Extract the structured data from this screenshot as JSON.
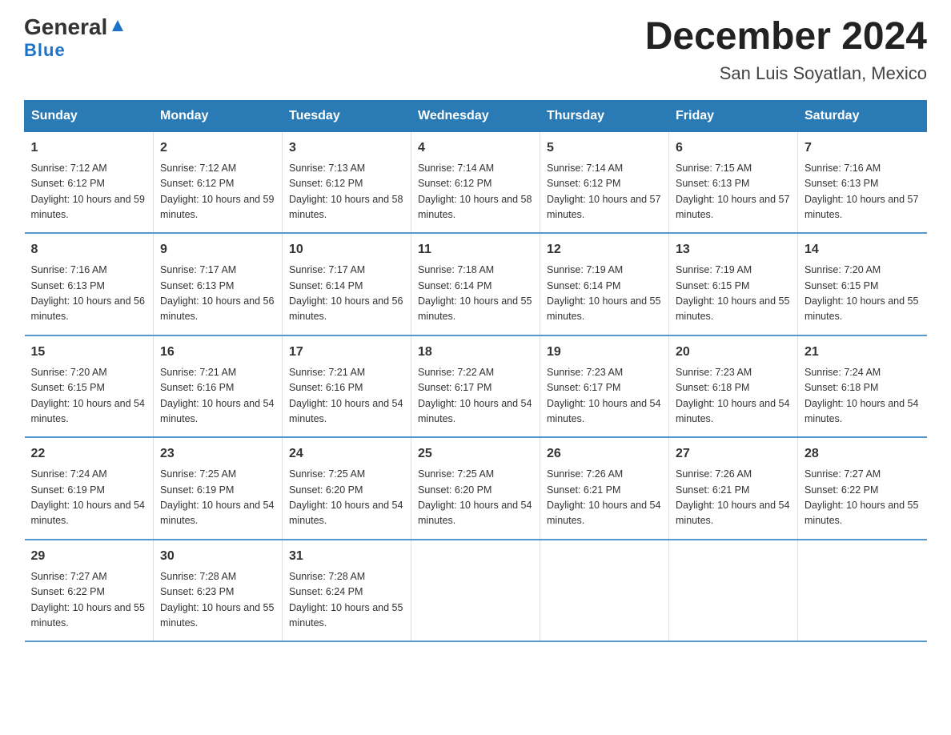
{
  "header": {
    "logo_general": "General",
    "logo_blue": "Blue",
    "month_title": "December 2024",
    "location": "San Luis Soyatlan, Mexico"
  },
  "days_of_week": [
    "Sunday",
    "Monday",
    "Tuesday",
    "Wednesday",
    "Thursday",
    "Friday",
    "Saturday"
  ],
  "weeks": [
    [
      {
        "day": "1",
        "sunrise": "7:12 AM",
        "sunset": "6:12 PM",
        "daylight": "10 hours and 59 minutes."
      },
      {
        "day": "2",
        "sunrise": "7:12 AM",
        "sunset": "6:12 PM",
        "daylight": "10 hours and 59 minutes."
      },
      {
        "day": "3",
        "sunrise": "7:13 AM",
        "sunset": "6:12 PM",
        "daylight": "10 hours and 58 minutes."
      },
      {
        "day": "4",
        "sunrise": "7:14 AM",
        "sunset": "6:12 PM",
        "daylight": "10 hours and 58 minutes."
      },
      {
        "day": "5",
        "sunrise": "7:14 AM",
        "sunset": "6:12 PM",
        "daylight": "10 hours and 57 minutes."
      },
      {
        "day": "6",
        "sunrise": "7:15 AM",
        "sunset": "6:13 PM",
        "daylight": "10 hours and 57 minutes."
      },
      {
        "day": "7",
        "sunrise": "7:16 AM",
        "sunset": "6:13 PM",
        "daylight": "10 hours and 57 minutes."
      }
    ],
    [
      {
        "day": "8",
        "sunrise": "7:16 AM",
        "sunset": "6:13 PM",
        "daylight": "10 hours and 56 minutes."
      },
      {
        "day": "9",
        "sunrise": "7:17 AM",
        "sunset": "6:13 PM",
        "daylight": "10 hours and 56 minutes."
      },
      {
        "day": "10",
        "sunrise": "7:17 AM",
        "sunset": "6:14 PM",
        "daylight": "10 hours and 56 minutes."
      },
      {
        "day": "11",
        "sunrise": "7:18 AM",
        "sunset": "6:14 PM",
        "daylight": "10 hours and 55 minutes."
      },
      {
        "day": "12",
        "sunrise": "7:19 AM",
        "sunset": "6:14 PM",
        "daylight": "10 hours and 55 minutes."
      },
      {
        "day": "13",
        "sunrise": "7:19 AM",
        "sunset": "6:15 PM",
        "daylight": "10 hours and 55 minutes."
      },
      {
        "day": "14",
        "sunrise": "7:20 AM",
        "sunset": "6:15 PM",
        "daylight": "10 hours and 55 minutes."
      }
    ],
    [
      {
        "day": "15",
        "sunrise": "7:20 AM",
        "sunset": "6:15 PM",
        "daylight": "10 hours and 54 minutes."
      },
      {
        "day": "16",
        "sunrise": "7:21 AM",
        "sunset": "6:16 PM",
        "daylight": "10 hours and 54 minutes."
      },
      {
        "day": "17",
        "sunrise": "7:21 AM",
        "sunset": "6:16 PM",
        "daylight": "10 hours and 54 minutes."
      },
      {
        "day": "18",
        "sunrise": "7:22 AM",
        "sunset": "6:17 PM",
        "daylight": "10 hours and 54 minutes."
      },
      {
        "day": "19",
        "sunrise": "7:23 AM",
        "sunset": "6:17 PM",
        "daylight": "10 hours and 54 minutes."
      },
      {
        "day": "20",
        "sunrise": "7:23 AM",
        "sunset": "6:18 PM",
        "daylight": "10 hours and 54 minutes."
      },
      {
        "day": "21",
        "sunrise": "7:24 AM",
        "sunset": "6:18 PM",
        "daylight": "10 hours and 54 minutes."
      }
    ],
    [
      {
        "day": "22",
        "sunrise": "7:24 AM",
        "sunset": "6:19 PM",
        "daylight": "10 hours and 54 minutes."
      },
      {
        "day": "23",
        "sunrise": "7:25 AM",
        "sunset": "6:19 PM",
        "daylight": "10 hours and 54 minutes."
      },
      {
        "day": "24",
        "sunrise": "7:25 AM",
        "sunset": "6:20 PM",
        "daylight": "10 hours and 54 minutes."
      },
      {
        "day": "25",
        "sunrise": "7:25 AM",
        "sunset": "6:20 PM",
        "daylight": "10 hours and 54 minutes."
      },
      {
        "day": "26",
        "sunrise": "7:26 AM",
        "sunset": "6:21 PM",
        "daylight": "10 hours and 54 minutes."
      },
      {
        "day": "27",
        "sunrise": "7:26 AM",
        "sunset": "6:21 PM",
        "daylight": "10 hours and 54 minutes."
      },
      {
        "day": "28",
        "sunrise": "7:27 AM",
        "sunset": "6:22 PM",
        "daylight": "10 hours and 55 minutes."
      }
    ],
    [
      {
        "day": "29",
        "sunrise": "7:27 AM",
        "sunset": "6:22 PM",
        "daylight": "10 hours and 55 minutes."
      },
      {
        "day": "30",
        "sunrise": "7:28 AM",
        "sunset": "6:23 PM",
        "daylight": "10 hours and 55 minutes."
      },
      {
        "day": "31",
        "sunrise": "7:28 AM",
        "sunset": "6:24 PM",
        "daylight": "10 hours and 55 minutes."
      },
      {
        "day": "",
        "sunrise": "",
        "sunset": "",
        "daylight": ""
      },
      {
        "day": "",
        "sunrise": "",
        "sunset": "",
        "daylight": ""
      },
      {
        "day": "",
        "sunrise": "",
        "sunset": "",
        "daylight": ""
      },
      {
        "day": "",
        "sunrise": "",
        "sunset": "",
        "daylight": ""
      }
    ]
  ]
}
